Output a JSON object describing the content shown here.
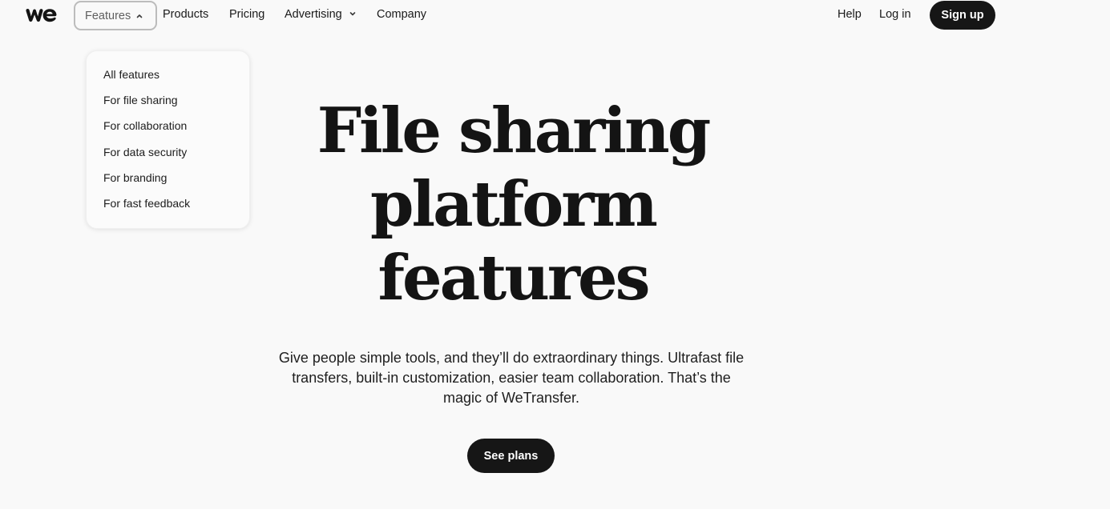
{
  "brand": {
    "logo_icon": "wetransfer-we-logo-icon"
  },
  "nav": {
    "features_label": "Features",
    "products_label": "Products",
    "pricing_label": "Pricing",
    "advertising_label": "Advertising",
    "company_label": "Company",
    "help_label": "Help",
    "login_label": "Log in",
    "signup_label": "Sign up"
  },
  "features_menu": {
    "items": [
      "All features",
      "For file sharing",
      "For collaboration",
      "For data security",
      "For branding",
      "For fast feedback"
    ]
  },
  "hero": {
    "title_lines": [
      "File sharing",
      "platform",
      "features"
    ],
    "subtitle": "Give people simple tools, and they’ll do extraordinary things. Ultrafast file transfers, built-in customization, easier team collaboration. That’s the magic of WeTransfer.",
    "cta_label": "See plans"
  },
  "colors": {
    "background": "#f9f9f9",
    "text": "#161616",
    "button_dark": "#161616",
    "button_text": "#ffffff"
  }
}
